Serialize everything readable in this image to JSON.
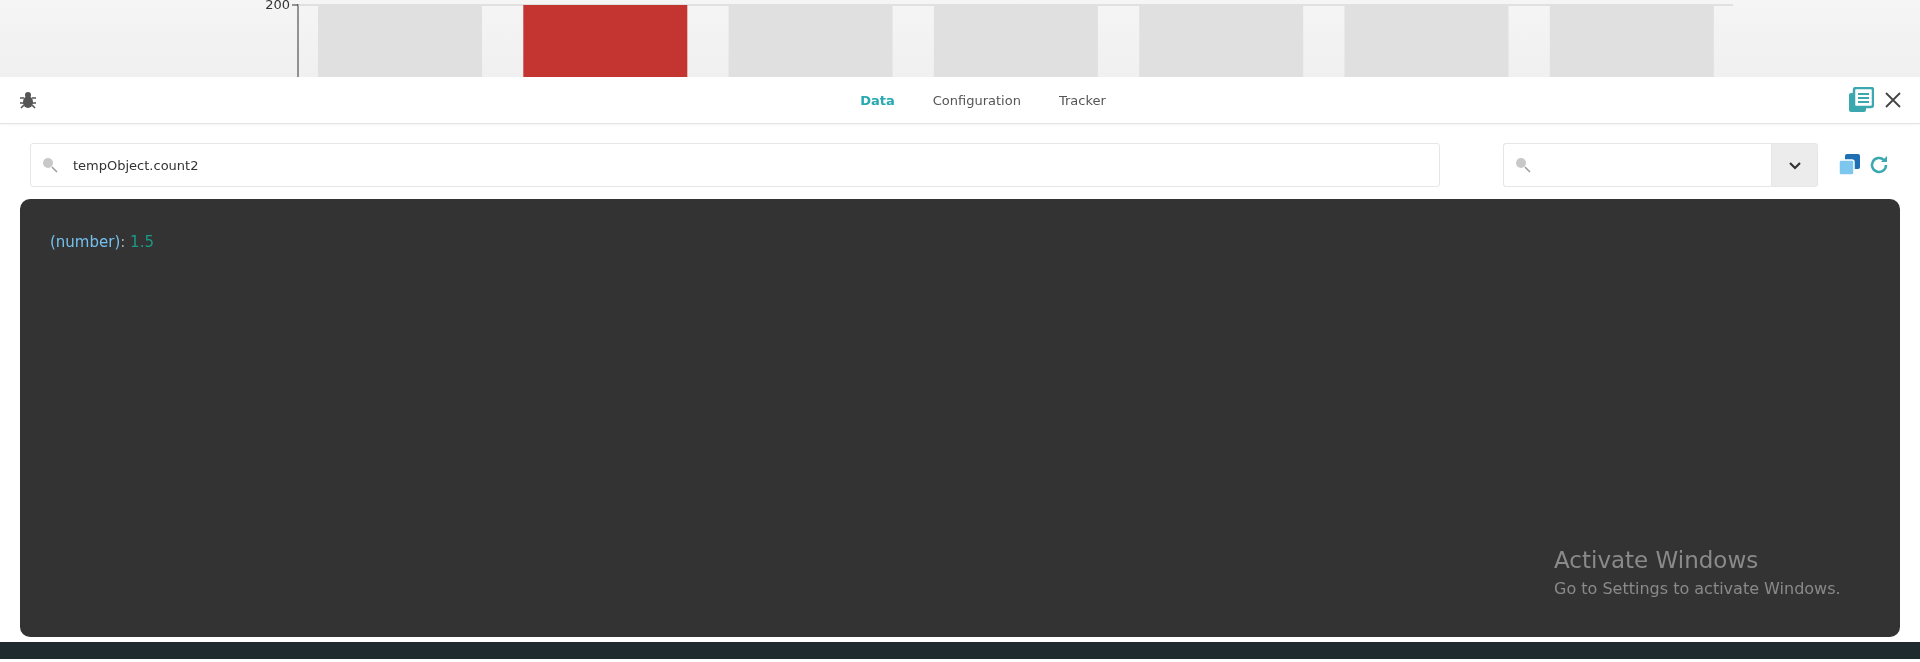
{
  "chart": {
    "axis_label": "200",
    "bars": [
      {
        "selected": false
      },
      {
        "selected": true
      },
      {
        "selected": false
      },
      {
        "selected": false
      },
      {
        "selected": false
      },
      {
        "selected": false
      },
      {
        "selected": false
      }
    ]
  },
  "toolbar": {
    "tabs": [
      {
        "label": "Data",
        "selected": true
      },
      {
        "label": "Configuration",
        "selected": false
      },
      {
        "label": "Tracker",
        "selected": false
      }
    ]
  },
  "search": {
    "value": "tempObject.count2"
  },
  "output": {
    "type": "(number)",
    "separator": ":",
    "value": "1.5"
  },
  "activation_notice": {
    "title": "Activate Windows",
    "text": "Go to Settings to activate Windows."
  }
}
